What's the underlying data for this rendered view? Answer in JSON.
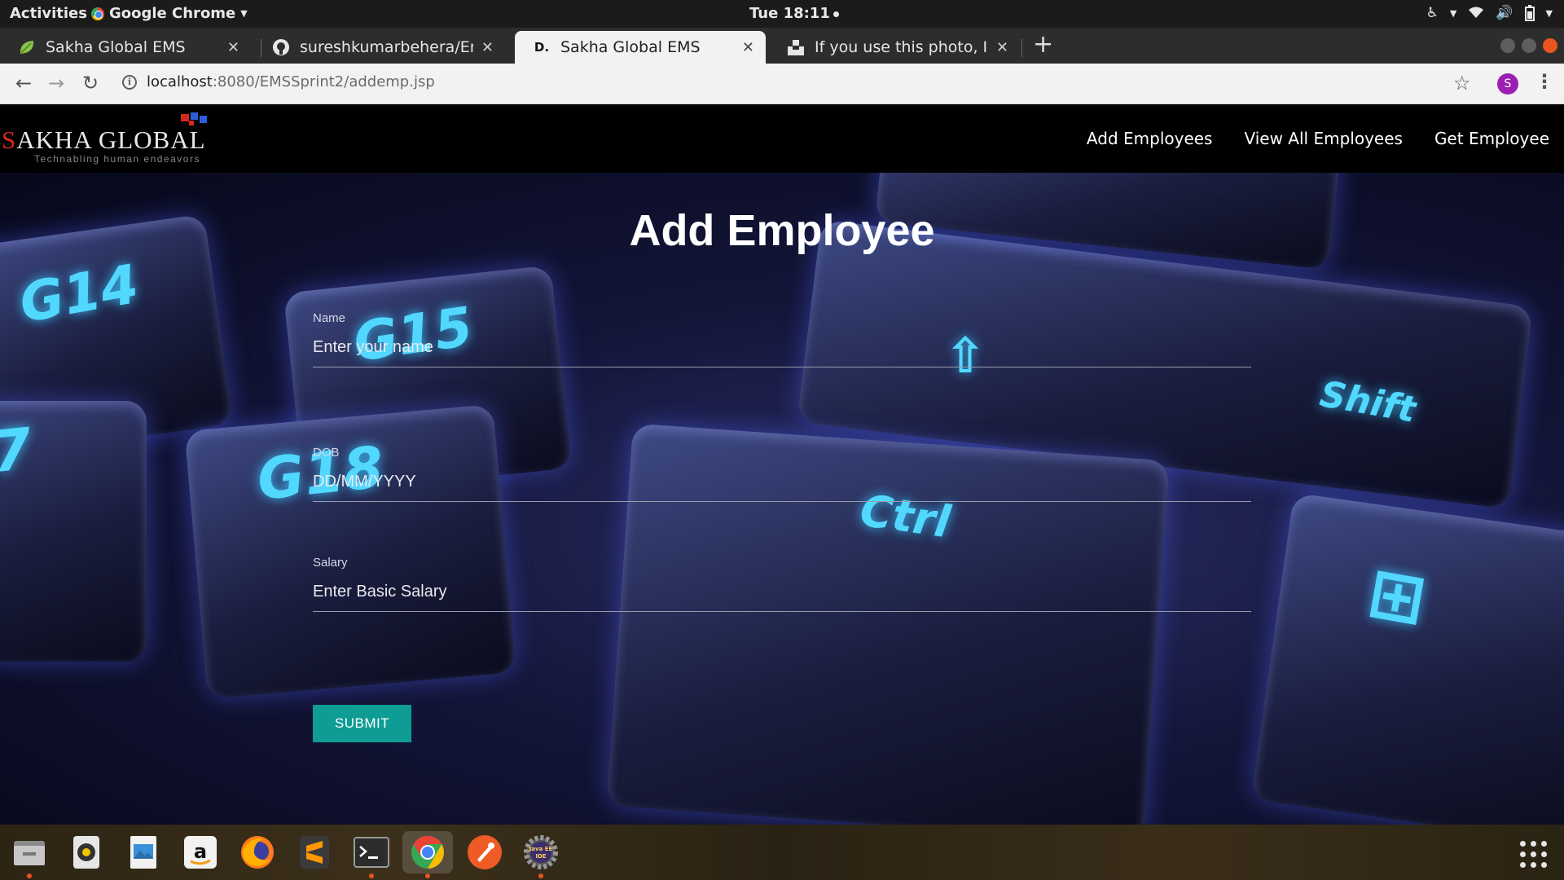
{
  "system_bar": {
    "activities": "Activities",
    "app_name": "Google Chrome",
    "clock": "Tue 18:11"
  },
  "browser": {
    "tabs": [
      {
        "title": "Sakha Global EMS",
        "favicon": "leaf-icon",
        "active": false
      },
      {
        "title": "sureshkumarbehera/Empl",
        "favicon": "github-icon",
        "active": false
      },
      {
        "title": "Sakha Global EMS",
        "favicon": "d-logo-icon",
        "active": true
      },
      {
        "title": "If you use this photo, I wo",
        "favicon": "unsplash-icon",
        "active": false
      }
    ],
    "url_host": "localhost",
    "url_path": ":8080/EMSSprint2/addemp.jsp",
    "profile_initial": "S"
  },
  "site": {
    "logo_prefix": "S",
    "logo_rest": "AKHA GLOBAL",
    "logo_tagline": "Technabling human endeavors",
    "nav": [
      "Add Employees",
      "View All Employees",
      "Get Employee"
    ],
    "background_keys": [
      "G14",
      "G15",
      "G18",
      "Ctrl",
      "Shift",
      "7"
    ]
  },
  "form": {
    "title": "Add Employee",
    "fields": [
      {
        "label": "Name",
        "placeholder": "Enter your name"
      },
      {
        "label": "DOB",
        "placeholder": "DD/MM/YYYY"
      },
      {
        "label": "Salary",
        "placeholder": "Enter Basic Salary"
      }
    ],
    "submit_label": "SUBMIT"
  },
  "dock": {
    "apps": [
      "files-icon",
      "rhythmbox-icon",
      "image-viewer-icon",
      "amazon-icon",
      "firefox-icon",
      "sublime-text-icon",
      "terminal-icon",
      "chrome-icon",
      "postman-icon",
      "eclipse-java-ee-icon"
    ],
    "java_ee_label": "Java EE IDE"
  },
  "colors": {
    "accent_button": "#0e9c94",
    "nav_background": "#000000",
    "logo_red": "#d7281f",
    "profile_purple": "#9b1fb5"
  }
}
